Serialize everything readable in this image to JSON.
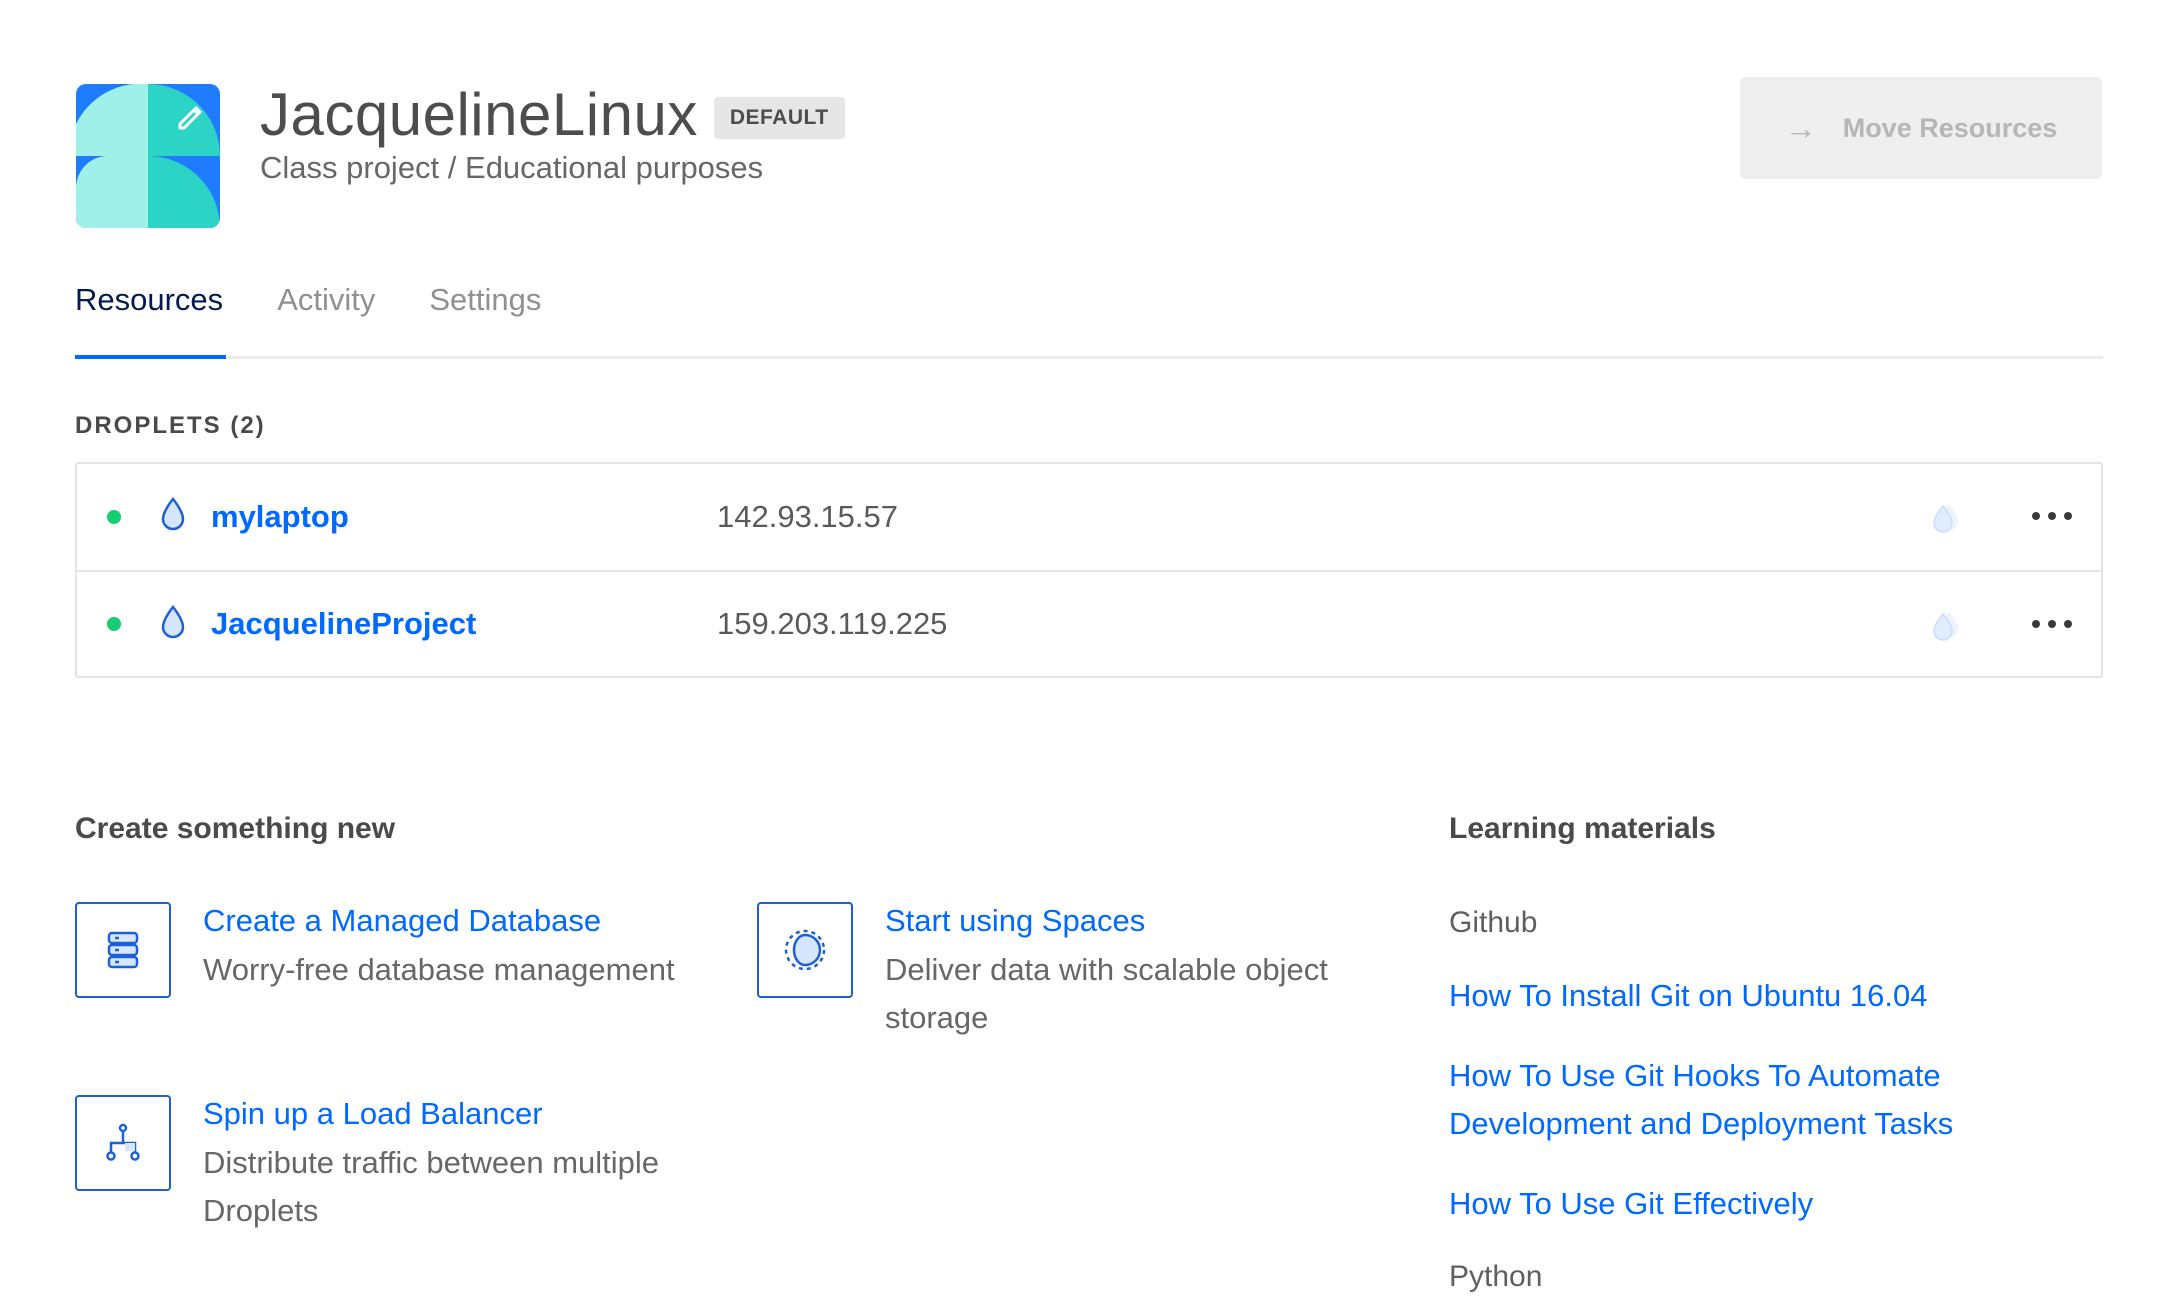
{
  "project": {
    "name": "JacquelineLinux",
    "badge": "DEFAULT",
    "description": "Class project / Educational purposes",
    "avatar_icon": "pencil-icon"
  },
  "move_button": {
    "label": "Move Resources",
    "icon": "arrow-right-icon"
  },
  "tabs": [
    {
      "label": "Resources",
      "active": true
    },
    {
      "label": "Activity",
      "active": false
    },
    {
      "label": "Settings",
      "active": false
    }
  ],
  "droplets": {
    "label": "DROPLETS (2)",
    "rows": [
      {
        "name": "mylaptop",
        "ip": "142.93.15.57",
        "status": "active"
      },
      {
        "name": "JacquelineProject",
        "ip": "159.203.119.225",
        "status": "active"
      }
    ]
  },
  "create": {
    "heading": "Create something new",
    "items": [
      {
        "title": "Create a Managed Database",
        "desc": "Worry-free database management",
        "icon": "database-icon"
      },
      {
        "title": "Start using Spaces",
        "desc": "Deliver data with scalable object storage",
        "icon": "spaces-icon"
      },
      {
        "title": "Spin up a Load Balancer",
        "desc": "Distribute traffic between multiple Droplets",
        "icon": "load-balancer-icon"
      }
    ]
  },
  "learning": {
    "heading": "Learning materials",
    "categories": [
      {
        "name": "Github",
        "links": [
          "How To Install Git on Ubuntu 16.04",
          "How To Use Git Hooks To Automate Development and Deployment Tasks",
          "How To Use Git Effectively"
        ]
      },
      {
        "name": "Python",
        "links": []
      }
    ]
  },
  "colors": {
    "accent": "#0069ff",
    "status_active": "#15cd72",
    "nav_active": "#031b4e"
  }
}
